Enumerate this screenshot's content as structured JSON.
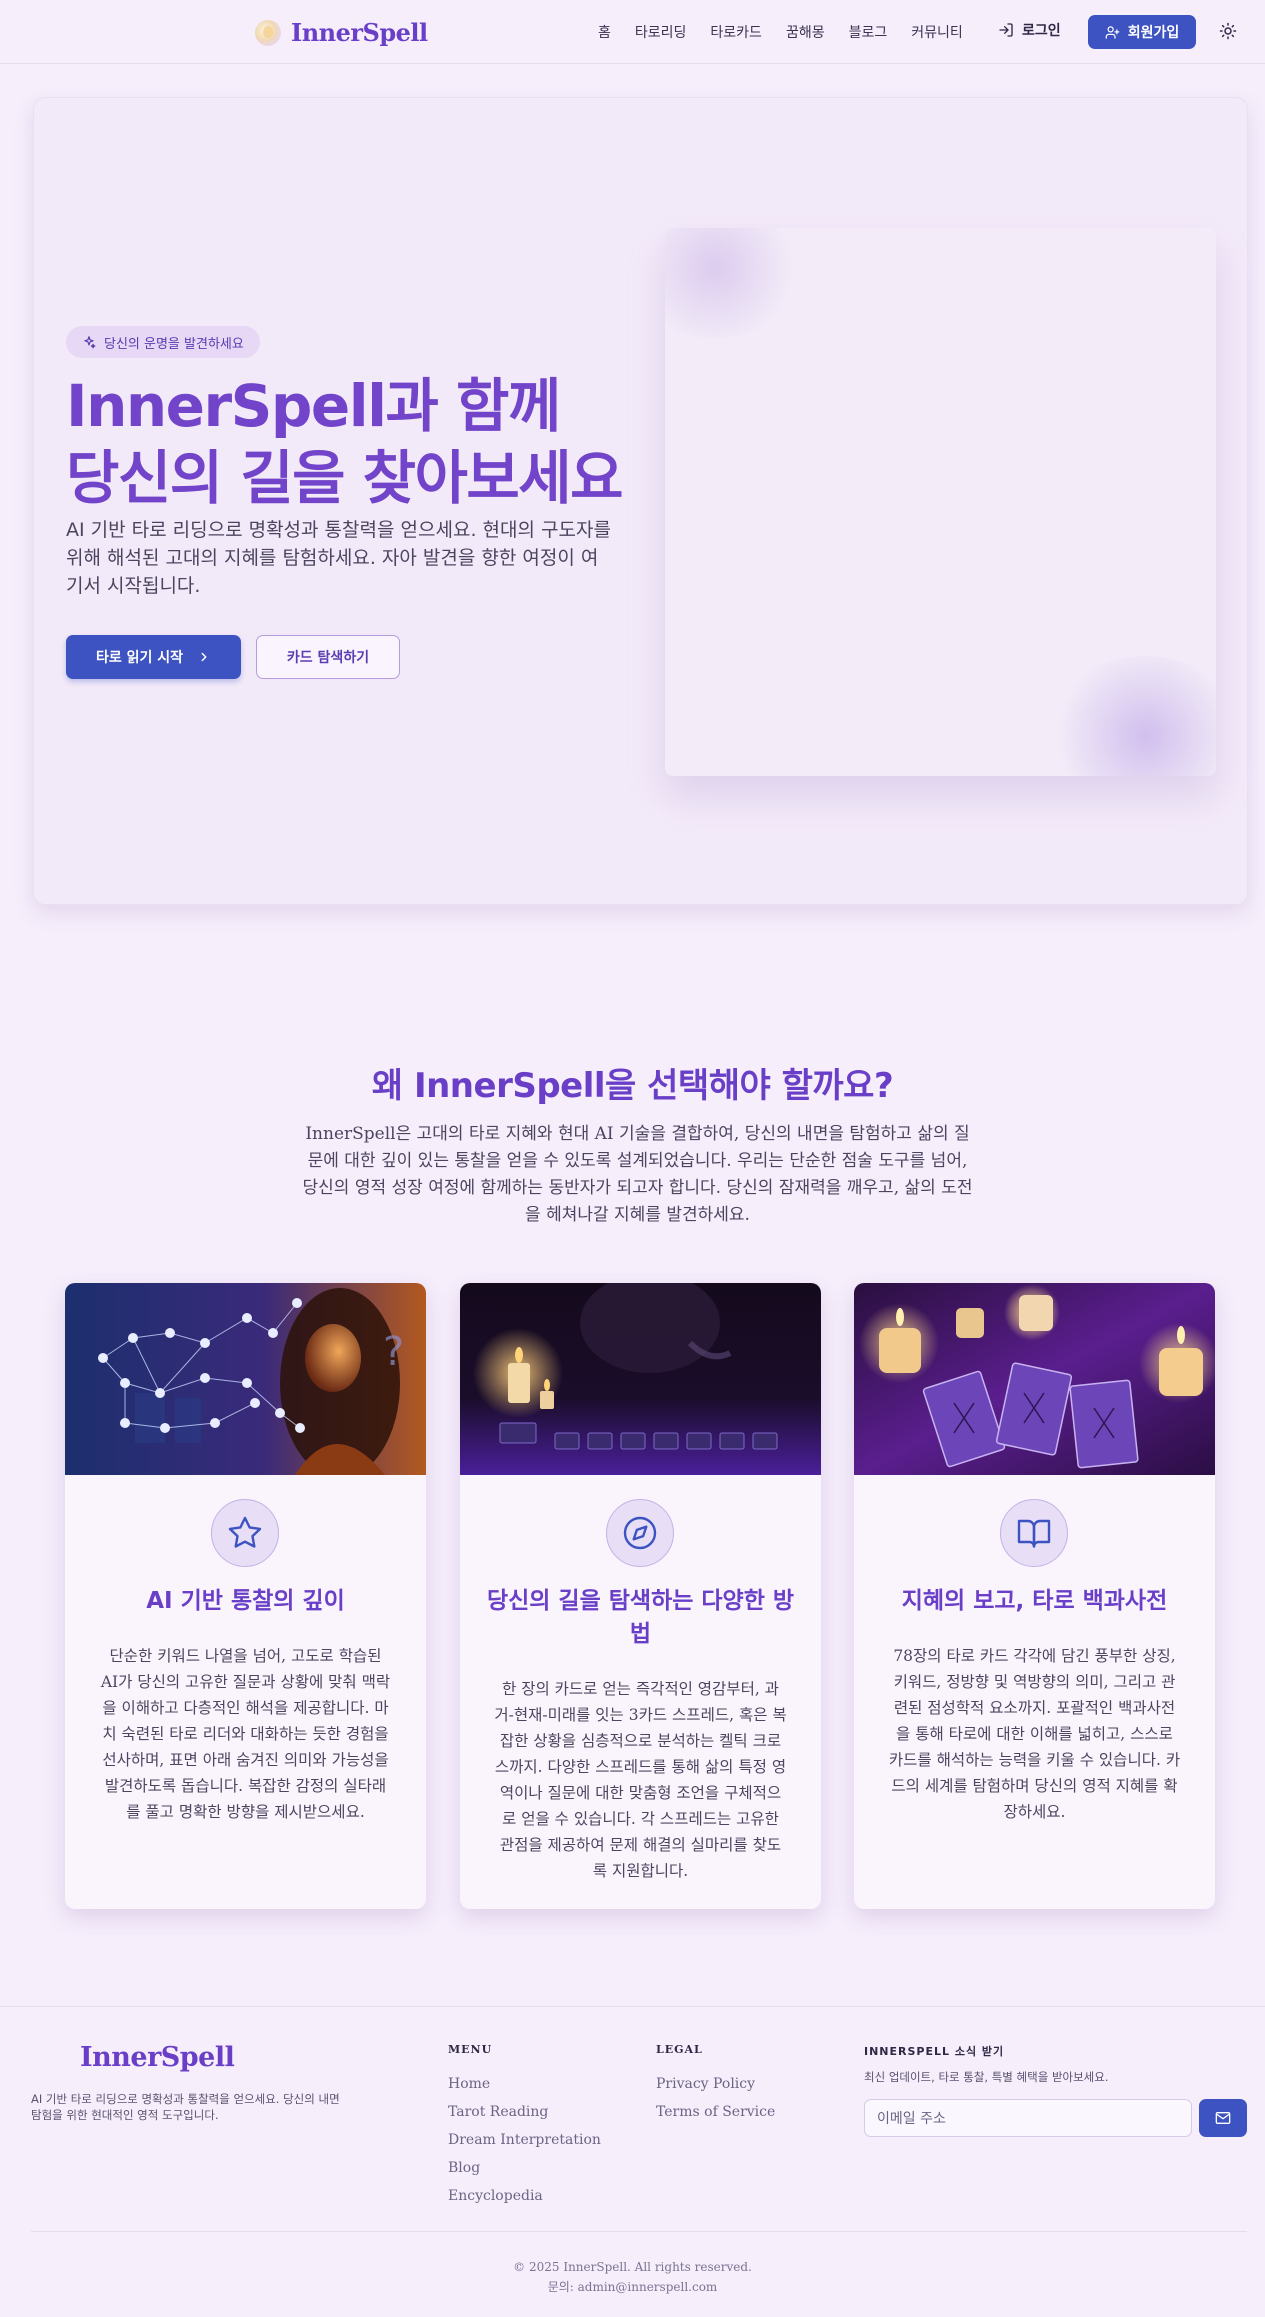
{
  "header": {
    "brand": "InnerSpell",
    "nav": [
      "홈",
      "타로리딩",
      "타로카드",
      "꿈해몽",
      "블로그",
      "커뮤니티"
    ],
    "login": "로그인",
    "signup": "회원가입"
  },
  "hero": {
    "badge": "당신의 운명을 발견하세요",
    "title": "InnerSpell과 함께 당신의 길을 찾아보세요",
    "description": "AI 기반 타로 리딩으로 명확성과 통찰력을 얻으세요. 현대의 구도자를 위해 해석된 고대의 지혜를 탐험하세요. 자아 발견을 향한 여정이 여기서 시작됩니다.",
    "primary_button": "타로 읽기 시작",
    "secondary_button": "카드 탐색하기"
  },
  "why": {
    "title": "왜 InnerSpell을 선택해야 할까요?",
    "description": "InnerSpell은 고대의 타로 지혜와 현대 AI 기술을 결합하여, 당신의 내면을 탐험하고 삶의 질문에 대한 깊이 있는 통찰을 얻을 수 있도록 설계되었습니다. 우리는 단순한 점술 도구를 넘어, 당신의 영적 성장 여정에 함께하는 동반자가 되고자 합니다. 당신의 잠재력을 깨우고, 삶의 도전을 헤쳐나갈 지혜를 발견하세요."
  },
  "cards": [
    {
      "title": "AI 기반 통찰의 깊이",
      "text": "단순한 키워드 나열을 넘어, 고도로 학습된 AI가 당신의 고유한 질문과 상황에 맞춰 맥락을 이해하고 다층적인 해석을 제공합니다. 마치 숙련된 타로 리더와 대화하는 듯한 경험을 선사하며, 표면 아래 숨겨진 의미와 가능성을 발견하도록 돕습니다. 복잡한 감정의 실타래를 풀고 명확한 방향을 제시받으세요.",
      "icon": "star-icon"
    },
    {
      "title": "당신의 길을 탐색하는 다양한 방법",
      "text": "한 장의 카드로 얻는 즉각적인 영감부터, 과거-현재-미래를 잇는 3카드 스프레드, 혹은 복잡한 상황을 심층적으로 분석하는 켈틱 크로스까지. 다양한 스프레드를 통해 삶의 특정 영역이나 질문에 대한 맞춤형 조언을 구체적으로 얻을 수 있습니다. 각 스프레드는 고유한 관점을 제공하여 문제 해결의 실마리를 찾도록 지원합니다.",
      "icon": "compass-icon"
    },
    {
      "title": "지혜의 보고, 타로 백과사전",
      "text": "78장의 타로 카드 각각에 담긴 풍부한 상징, 키워드, 정방향 및 역방향의 의미, 그리고 관련된 점성학적 요소까지. 포괄적인 백과사전을 통해 타로에 대한 이해를 넓히고, 스스로 카드를 해석하는 능력을 키울 수 있습니다. 카드의 세계를 탐험하며 당신의 영적 지혜를 확장하세요.",
      "icon": "book-open-icon"
    }
  ],
  "footer": {
    "brand": "InnerSpell",
    "description": "AI 기반 타로 리딩으로 명확성과 통찰력을 얻으세요. 당신의 내면 탐험을 위한 현대적인 영적 도구입니다.",
    "menu_title": "MENU",
    "menu": [
      "Home",
      "Tarot Reading",
      "Dream Interpretation",
      "Blog",
      "Encyclopedia"
    ],
    "legal_title": "LEGAL",
    "legal": [
      "Privacy Policy",
      "Terms of Service"
    ],
    "news_title": "INNERSPELL 소식 받기",
    "news_desc": "최신 업데이트, 타로 통찰, 특별 혜택을 받아보세요.",
    "email_placeholder": "이메일 주소",
    "copyright": "© 2025 InnerSpell. All rights reserved.",
    "contact": "문의: admin@innerspell.com"
  }
}
